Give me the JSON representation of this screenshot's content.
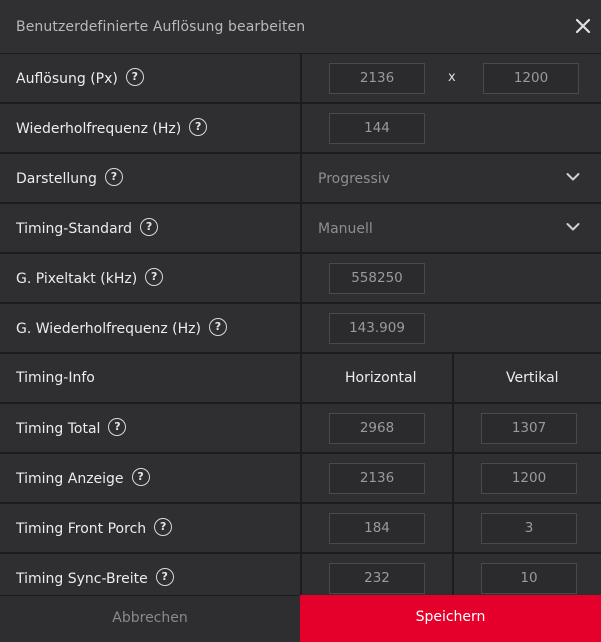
{
  "dialog": {
    "title": "Benutzerdefinierte Auflösung bearbeiten",
    "close_icon": "close-icon"
  },
  "rows": {
    "resolution": {
      "label": "Auflösung (Px)",
      "width": "2136",
      "sep": "x",
      "height": "1200"
    },
    "refresh": {
      "label": "Wiederholfrequenz (Hz)",
      "value": "144"
    },
    "display": {
      "label": "Darstellung",
      "value": "Progressiv"
    },
    "timing_standard": {
      "label": "Timing-Standard",
      "value": "Manuell"
    },
    "pixel_clock": {
      "label": "G. Pixeltakt (kHz)",
      "value": "558250"
    },
    "g_refresh": {
      "label": "G. Wiederholfrequenz (Hz)",
      "value": "143.909"
    },
    "timing_info": {
      "label": "Timing-Info",
      "horizontal": "Horizontal",
      "vertical": "Vertikal"
    },
    "timing_total": {
      "label": "Timing Total",
      "h": "2968",
      "v": "1307"
    },
    "timing_display": {
      "label": "Timing Anzeige",
      "h": "2136",
      "v": "1200"
    },
    "front_porch": {
      "label": "Timing Front Porch",
      "h": "184",
      "v": "3"
    },
    "sync_width": {
      "label": "Timing Sync-Breite",
      "h": "232",
      "v": "10"
    }
  },
  "footer": {
    "cancel": "Abbrechen",
    "save": "Speichern"
  },
  "help_glyph": "?",
  "colors": {
    "accent": "#e4002b",
    "background": "#2e2e30",
    "border": "#1c1c1e"
  }
}
